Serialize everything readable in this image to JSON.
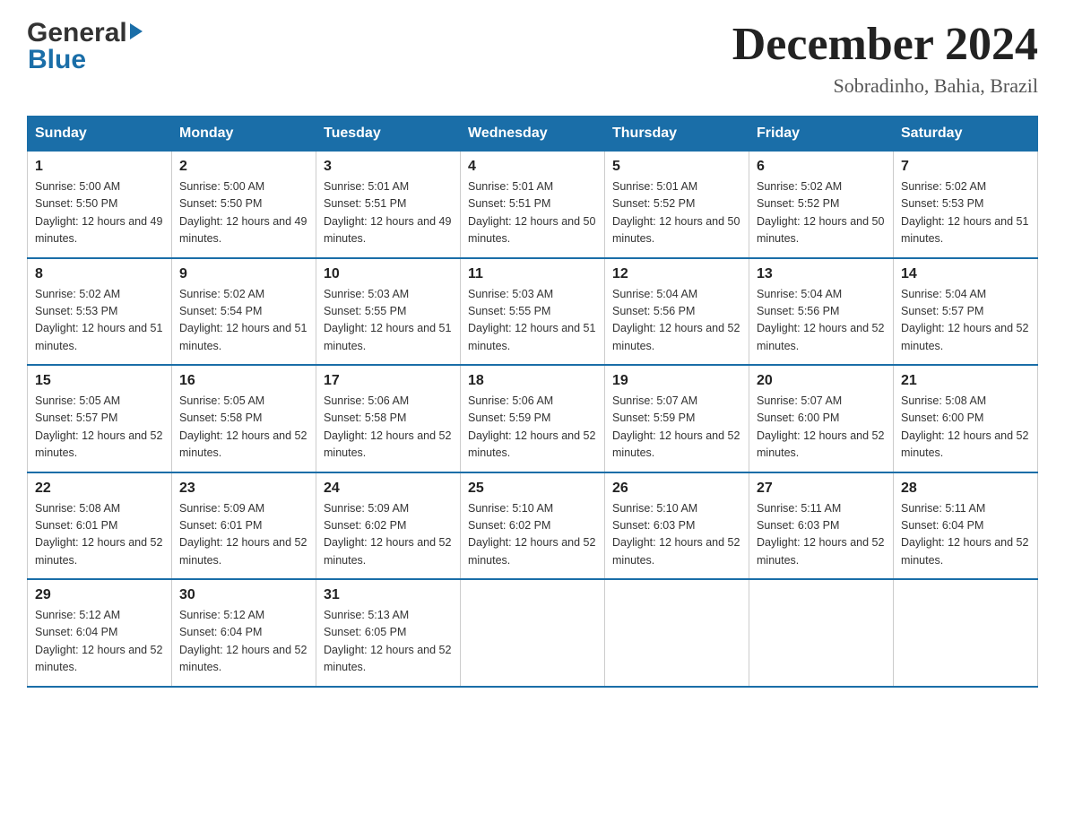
{
  "header": {
    "title": "December 2024",
    "subtitle": "Sobradinho, Bahia, Brazil",
    "logo_general": "General",
    "logo_blue": "Blue"
  },
  "calendar": {
    "days_of_week": [
      "Sunday",
      "Monday",
      "Tuesday",
      "Wednesday",
      "Thursday",
      "Friday",
      "Saturday"
    ],
    "weeks": [
      [
        {
          "day": "1",
          "sunrise": "5:00 AM",
          "sunset": "5:50 PM",
          "daylight": "12 hours and 49 minutes."
        },
        {
          "day": "2",
          "sunrise": "5:00 AM",
          "sunset": "5:50 PM",
          "daylight": "12 hours and 49 minutes."
        },
        {
          "day": "3",
          "sunrise": "5:01 AM",
          "sunset": "5:51 PM",
          "daylight": "12 hours and 49 minutes."
        },
        {
          "day": "4",
          "sunrise": "5:01 AM",
          "sunset": "5:51 PM",
          "daylight": "12 hours and 50 minutes."
        },
        {
          "day": "5",
          "sunrise": "5:01 AM",
          "sunset": "5:52 PM",
          "daylight": "12 hours and 50 minutes."
        },
        {
          "day": "6",
          "sunrise": "5:02 AM",
          "sunset": "5:52 PM",
          "daylight": "12 hours and 50 minutes."
        },
        {
          "day": "7",
          "sunrise": "5:02 AM",
          "sunset": "5:53 PM",
          "daylight": "12 hours and 51 minutes."
        }
      ],
      [
        {
          "day": "8",
          "sunrise": "5:02 AM",
          "sunset": "5:53 PM",
          "daylight": "12 hours and 51 minutes."
        },
        {
          "day": "9",
          "sunrise": "5:02 AM",
          "sunset": "5:54 PM",
          "daylight": "12 hours and 51 minutes."
        },
        {
          "day": "10",
          "sunrise": "5:03 AM",
          "sunset": "5:55 PM",
          "daylight": "12 hours and 51 minutes."
        },
        {
          "day": "11",
          "sunrise": "5:03 AM",
          "sunset": "5:55 PM",
          "daylight": "12 hours and 51 minutes."
        },
        {
          "day": "12",
          "sunrise": "5:04 AM",
          "sunset": "5:56 PM",
          "daylight": "12 hours and 52 minutes."
        },
        {
          "day": "13",
          "sunrise": "5:04 AM",
          "sunset": "5:56 PM",
          "daylight": "12 hours and 52 minutes."
        },
        {
          "day": "14",
          "sunrise": "5:04 AM",
          "sunset": "5:57 PM",
          "daylight": "12 hours and 52 minutes."
        }
      ],
      [
        {
          "day": "15",
          "sunrise": "5:05 AM",
          "sunset": "5:57 PM",
          "daylight": "12 hours and 52 minutes."
        },
        {
          "day": "16",
          "sunrise": "5:05 AM",
          "sunset": "5:58 PM",
          "daylight": "12 hours and 52 minutes."
        },
        {
          "day": "17",
          "sunrise": "5:06 AM",
          "sunset": "5:58 PM",
          "daylight": "12 hours and 52 minutes."
        },
        {
          "day": "18",
          "sunrise": "5:06 AM",
          "sunset": "5:59 PM",
          "daylight": "12 hours and 52 minutes."
        },
        {
          "day": "19",
          "sunrise": "5:07 AM",
          "sunset": "5:59 PM",
          "daylight": "12 hours and 52 minutes."
        },
        {
          "day": "20",
          "sunrise": "5:07 AM",
          "sunset": "6:00 PM",
          "daylight": "12 hours and 52 minutes."
        },
        {
          "day": "21",
          "sunrise": "5:08 AM",
          "sunset": "6:00 PM",
          "daylight": "12 hours and 52 minutes."
        }
      ],
      [
        {
          "day": "22",
          "sunrise": "5:08 AM",
          "sunset": "6:01 PM",
          "daylight": "12 hours and 52 minutes."
        },
        {
          "day": "23",
          "sunrise": "5:09 AM",
          "sunset": "6:01 PM",
          "daylight": "12 hours and 52 minutes."
        },
        {
          "day": "24",
          "sunrise": "5:09 AM",
          "sunset": "6:02 PM",
          "daylight": "12 hours and 52 minutes."
        },
        {
          "day": "25",
          "sunrise": "5:10 AM",
          "sunset": "6:02 PM",
          "daylight": "12 hours and 52 minutes."
        },
        {
          "day": "26",
          "sunrise": "5:10 AM",
          "sunset": "6:03 PM",
          "daylight": "12 hours and 52 minutes."
        },
        {
          "day": "27",
          "sunrise": "5:11 AM",
          "sunset": "6:03 PM",
          "daylight": "12 hours and 52 minutes."
        },
        {
          "day": "28",
          "sunrise": "5:11 AM",
          "sunset": "6:04 PM",
          "daylight": "12 hours and 52 minutes."
        }
      ],
      [
        {
          "day": "29",
          "sunrise": "5:12 AM",
          "sunset": "6:04 PM",
          "daylight": "12 hours and 52 minutes."
        },
        {
          "day": "30",
          "sunrise": "5:12 AM",
          "sunset": "6:04 PM",
          "daylight": "12 hours and 52 minutes."
        },
        {
          "day": "31",
          "sunrise": "5:13 AM",
          "sunset": "6:05 PM",
          "daylight": "12 hours and 52 minutes."
        },
        null,
        null,
        null,
        null
      ]
    ]
  }
}
